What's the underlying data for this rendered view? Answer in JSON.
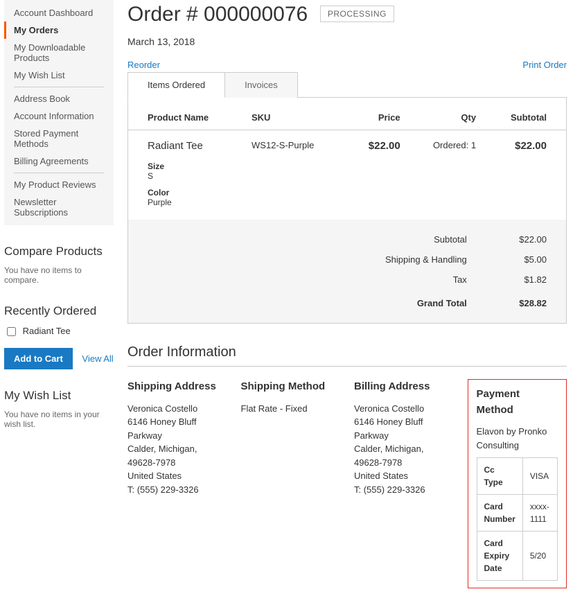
{
  "sidebar": {
    "groups": [
      [
        "Account Dashboard",
        "My Orders",
        "My Downloadable Products",
        "My Wish List"
      ],
      [
        "Address Book",
        "Account Information",
        "Stored Payment Methods",
        "Billing Agreements"
      ],
      [
        "My Product Reviews",
        "Newsletter Subscriptions"
      ]
    ],
    "current": "My Orders"
  },
  "compare": {
    "title": "Compare Products",
    "empty": "You have no items to compare."
  },
  "recent": {
    "title": "Recently Ordered",
    "item": "Radiant Tee",
    "add": "Add to Cart",
    "viewall": "View All"
  },
  "wishlist": {
    "title": "My Wish List",
    "empty": "You have no items in your wish list."
  },
  "order": {
    "title": "Order # 000000076",
    "status": "PROCESSING",
    "date": "March 13, 2018",
    "reorder": "Reorder",
    "print": "Print Order"
  },
  "tabs": {
    "items": "Items Ordered",
    "invoices": "Invoices"
  },
  "tableHead": {
    "name": "Product Name",
    "sku": "SKU",
    "price": "Price",
    "qty": "Qty",
    "subtotal": "Subtotal"
  },
  "line": {
    "name": "Radiant Tee",
    "sku": "WS12-S-Purple",
    "price": "$22.00",
    "qty": "Ordered: 1",
    "subtotal": "$22.00",
    "opt1Label": "Size",
    "opt1Value": "S",
    "opt2Label": "Color",
    "opt2Value": "Purple"
  },
  "totals": {
    "subtotalL": "Subtotal",
    "subtotalV": "$22.00",
    "shipL": "Shipping & Handling",
    "shipV": "$5.00",
    "taxL": "Tax",
    "taxV": "$1.82",
    "grandL": "Grand Total",
    "grandV": "$28.82"
  },
  "infoTitle": "Order Information",
  "ship": {
    "title": "Shipping Address",
    "l1": "Veronica Costello",
    "l2": "6146 Honey Bluff Parkway",
    "l3": "Calder, Michigan, 49628-7978",
    "l4": "United States",
    "l5": "T: (555) 229-3326"
  },
  "method": {
    "title": "Shipping Method",
    "value": "Flat Rate - Fixed"
  },
  "bill": {
    "title": "Billing Address",
    "l1": "Veronica Costello",
    "l2": "6146 Honey Bluff Parkway",
    "l3": "Calder, Michigan, 49628-7978",
    "l4": "United States",
    "l5": "T: (555) 229-3326"
  },
  "payment": {
    "title": "Payment Method",
    "provider": "Elavon by Pronko Consulting",
    "r1k": "Cc Type",
    "r1v": "VISA",
    "r2k": "Card Number",
    "r2v": "xxxx-1111",
    "r3k": "Card Expiry Date",
    "r3v": "5/20"
  }
}
